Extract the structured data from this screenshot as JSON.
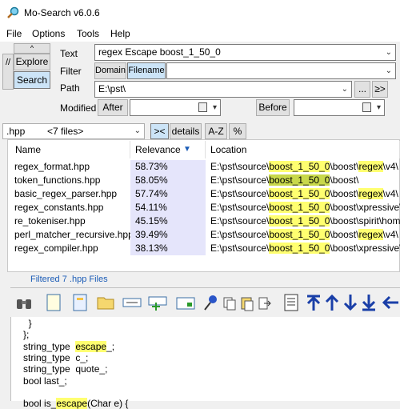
{
  "window": {
    "title": "Mo-Search v6.0.6"
  },
  "menu": [
    "File",
    "Options",
    "Tools",
    "Help"
  ],
  "mode": {
    "up": "^",
    "slash": "//",
    "explore": "Explore",
    "search": "Search"
  },
  "search": {
    "text_label": "Text",
    "text_value": "regex Escape boost_1_50_0",
    "filter_label": "Filter",
    "filter_domain": "Domain",
    "filter_filename": "Filename",
    "path_label": "Path",
    "path_value": "E:\\pst\\",
    "path_browse": "...",
    "path_go": "≥>",
    "modified_label": "Modified",
    "after_label": "After",
    "before_label": "Before"
  },
  "filterbar": {
    "ext_value": ".hpp",
    "file_count": "<7 files>",
    "collapse_label": "><",
    "details_label": "details",
    "sort_label": "A-Z",
    "percent_label": "%"
  },
  "results": {
    "columns": [
      "Name",
      "Relevance",
      "Location"
    ],
    "rows": [
      {
        "name": "regex_format.hpp",
        "relevance": "58.73%",
        "loc_pre": "E:\\pst\\source\\",
        "loc_hl1": "boost_1_50_0",
        "loc_mid": "\\boost\\",
        "loc_hl2": "regex",
        "loc_post": "\\v4\\"
      },
      {
        "name": "token_functions.hpp",
        "relevance": "58.05%",
        "loc_pre": "E:\\pst\\source\\",
        "loc_hl1": "boost_1_50_0",
        "loc_mid": "\\boost\\",
        "loc_hl2": "",
        "loc_post": ""
      },
      {
        "name": "basic_regex_parser.hpp",
        "relevance": "57.74%",
        "loc_pre": "E:\\pst\\source\\",
        "loc_hl1": "boost_1_50_0",
        "loc_mid": "\\boost\\",
        "loc_hl2": "regex",
        "loc_post": "\\v4\\"
      },
      {
        "name": "regex_constants.hpp",
        "relevance": "54.11%",
        "loc_pre": "E:\\pst\\source\\",
        "loc_hl1": "boost_1_50_0",
        "loc_mid": "\\boost\\xpressive\\",
        "loc_hl2": "",
        "loc_post": ""
      },
      {
        "name": "re_tokeniser.hpp",
        "relevance": "45.15%",
        "loc_pre": "E:\\pst\\source\\",
        "loc_hl1": "boost_1_50_0",
        "loc_mid": "\\boost\\spirit\\home\\su",
        "loc_hl2": "",
        "loc_post": ""
      },
      {
        "name": "perl_matcher_recursive.hpp",
        "relevance": "39.49%",
        "loc_pre": "E:\\pst\\source\\",
        "loc_hl1": "boost_1_50_0",
        "loc_mid": "\\boost\\",
        "loc_hl2": "regex",
        "loc_post": "\\v4\\"
      },
      {
        "name": "regex_compiler.hpp",
        "relevance": "38.13%",
        "loc_pre": "E:\\pst\\source\\",
        "loc_hl1": "boost_1_50_0",
        "loc_mid": "\\boost\\xpressive\\",
        "loc_hl2": "",
        "loc_post": ""
      }
    ]
  },
  "status": {
    "filtered": "Filtered 7 .hpp Files"
  },
  "editor": {
    "lines": [
      {
        "pre": "  }",
        "hl": "",
        "post": ""
      },
      {
        "pre": "};",
        "hl": "",
        "post": ""
      },
      {
        "pre": "string_type  ",
        "hl": "escape",
        "post": "_;"
      },
      {
        "pre": "string_type  c_;",
        "hl": "",
        "post": ""
      },
      {
        "pre": "string_type  quote_;",
        "hl": "",
        "post": ""
      },
      {
        "pre": "bool last_;",
        "hl": "",
        "post": ""
      },
      {
        "pre": "",
        "hl": "",
        "post": ""
      },
      {
        "pre": "bool is_",
        "hl": "escape",
        "post": "(Char e) {"
      }
    ]
  },
  "colors": {
    "accent": "#1c5db7",
    "highlight": "#ffff70",
    "relevance_bg": "#e5e5fb"
  }
}
